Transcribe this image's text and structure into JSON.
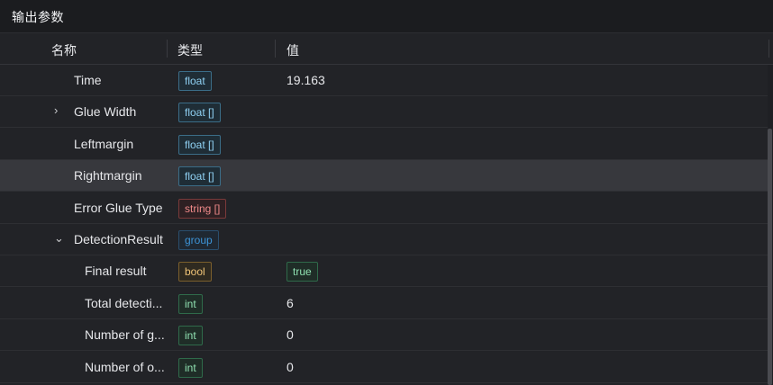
{
  "panel": {
    "title": "输出参数"
  },
  "columns": {
    "name": "名称",
    "type": "类型",
    "value": "值"
  },
  "rows": [
    {
      "name": "Time",
      "type": "float",
      "type_style": "float",
      "value": "19.163",
      "expander": "",
      "indent": 1
    },
    {
      "name": "Glue Width",
      "type": "float []",
      "type_style": "float",
      "value": "",
      "expander": "›",
      "indent": 1
    },
    {
      "name": "Leftmargin",
      "type": "float []",
      "type_style": "float",
      "value": "",
      "expander": "",
      "indent": 1
    },
    {
      "name": "Rightmargin",
      "type": "float []",
      "type_style": "float",
      "value": "",
      "expander": "",
      "indent": 1,
      "selected": true
    },
    {
      "name": "Error Glue Type",
      "type": "string []",
      "type_style": "string",
      "value": "",
      "expander": "",
      "indent": 1
    },
    {
      "name": "DetectionResult",
      "type": "group",
      "type_style": "group",
      "value": "",
      "expander": "⌄",
      "indent": 1
    },
    {
      "name": "Final result",
      "type": "bool",
      "type_style": "bool",
      "value": "true",
      "value_is_tag": true,
      "expander": "",
      "indent": 2
    },
    {
      "name": "Total detecti...",
      "type": "int",
      "type_style": "int",
      "value": "6",
      "expander": "",
      "indent": 2
    },
    {
      "name": "Number of g...",
      "type": "int",
      "type_style": "int",
      "value": "0",
      "expander": "",
      "indent": 2
    },
    {
      "name": "Number of o...",
      "type": "int",
      "type_style": "int",
      "value": "0",
      "expander": "",
      "indent": 2
    }
  ]
}
